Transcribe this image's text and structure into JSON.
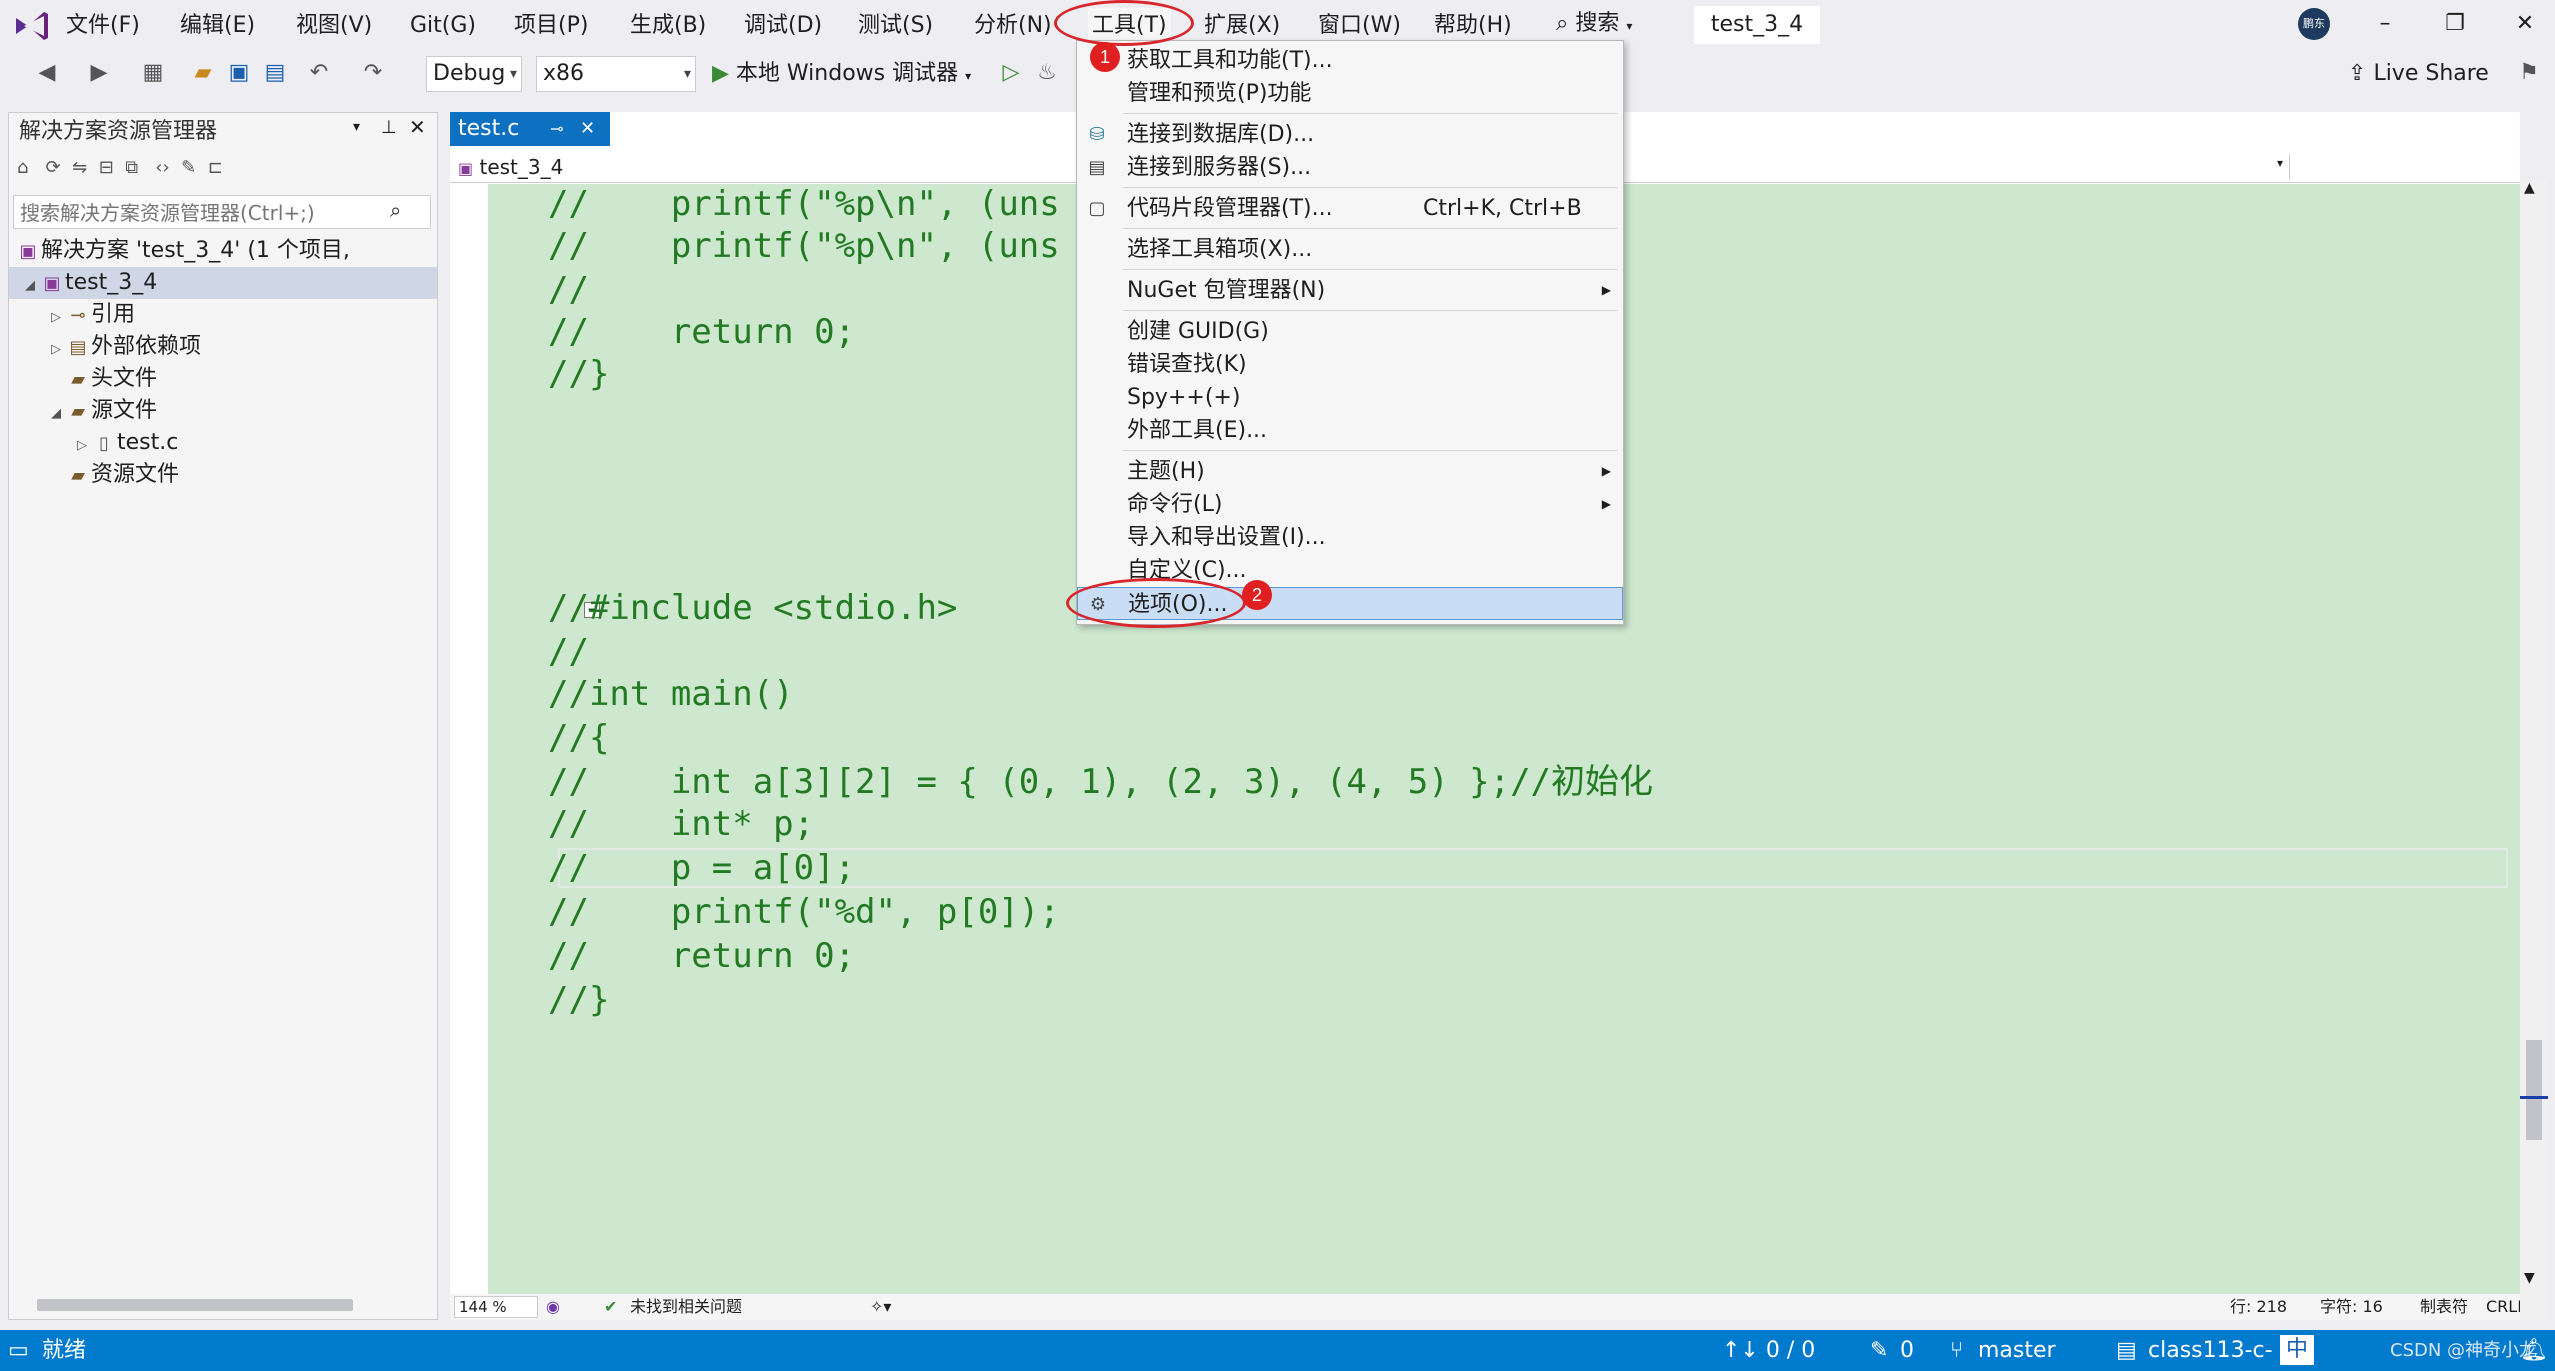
{
  "menubar": {
    "items": [
      "文件(F)",
      "编辑(E)",
      "视图(V)",
      "Git(G)",
      "项目(P)",
      "生成(B)",
      "调试(D)",
      "测试(S)",
      "分析(N)",
      "工具(T)",
      "扩展(X)",
      "窗口(W)",
      "帮助(H)"
    ],
    "search_label": "搜索",
    "project_title": "test_3_4",
    "avatar_text": "鹏东",
    "live_share": "Live Share"
  },
  "toolbar": {
    "config": "Debug",
    "platform": "x86",
    "run_label": "本地 Windows 调试器"
  },
  "solution_explorer": {
    "title": "解决方案资源管理器",
    "search_placeholder": "搜索解决方案资源管理器(Ctrl+;)",
    "nodes": [
      {
        "label": "解决方案 'test_3_4' (1 个项目,"
      },
      {
        "label": "test_3_4"
      },
      {
        "label": "引用"
      },
      {
        "label": "外部依赖项"
      },
      {
        "label": "头文件"
      },
      {
        "label": "源文件"
      },
      {
        "label": "test.c"
      },
      {
        "label": "资源文件"
      }
    ]
  },
  "editor": {
    "tab_label": "test.c",
    "tab_pin": "⊸",
    "tab_close": "✕",
    "nav_scope": "test_3_4",
    "code_lines": [
      "//    printf(\"%p\\n\", (uns",
      "//    printf(\"%p\\n\", (uns",
      "//",
      "//    return 0;",
      "//}",
      "//#include <stdio.h>",
      "//",
      "//int main()",
      "//{",
      "//    int a[3][2] = { (0, 1), (2, 3), (4, 5) };//初始化",
      "//    int* p;",
      "//    p = a[0];",
      "//    printf(\"%d\", p[0]);",
      "//    return 0;",
      "//}"
    ],
    "zoom": "144 %",
    "issues": "未找到相关问题",
    "line_info": "行: 218",
    "col_info": "字符: 16",
    "tab_mode": "制表符",
    "eol": "CRLF"
  },
  "tools_menu": {
    "items": [
      {
        "label": "获取工具和功能(T)..."
      },
      {
        "label": "管理和预览(P)功能"
      },
      {
        "label": "连接到数据库(D)..."
      },
      {
        "label": "连接到服务器(S)..."
      },
      {
        "label": "代码片段管理器(T)...",
        "shortcut": "Ctrl+K, Ctrl+B"
      },
      {
        "label": "选择工具箱项(X)..."
      },
      {
        "label": "NuGet 包管理器(N)"
      },
      {
        "label": "创建 GUID(G)"
      },
      {
        "label": "错误查找(K)"
      },
      {
        "label": "Spy++(+)"
      },
      {
        "label": "外部工具(E)..."
      },
      {
        "label": "主题(H)"
      },
      {
        "label": "命令行(L)"
      },
      {
        "label": "导入和导出设置(I)..."
      },
      {
        "label": "自定义(C)..."
      },
      {
        "label": "选项(O)..."
      }
    ]
  },
  "annotations": {
    "step1": "1",
    "step2": "2",
    "ring_color": "#d9262c"
  },
  "statusbar": {
    "ready": "就绪",
    "sync": "↑↓ 0 / 0",
    "edits": "0",
    "branch": "master",
    "repo": "class113-c-",
    "ime": "中",
    "watermark": "CSDN @神奇小龙"
  },
  "colors": {
    "accent": "#007acc",
    "code_bg": "#cde8cf",
    "code_text": "#237a23",
    "tab_active": "#0e70c0"
  }
}
